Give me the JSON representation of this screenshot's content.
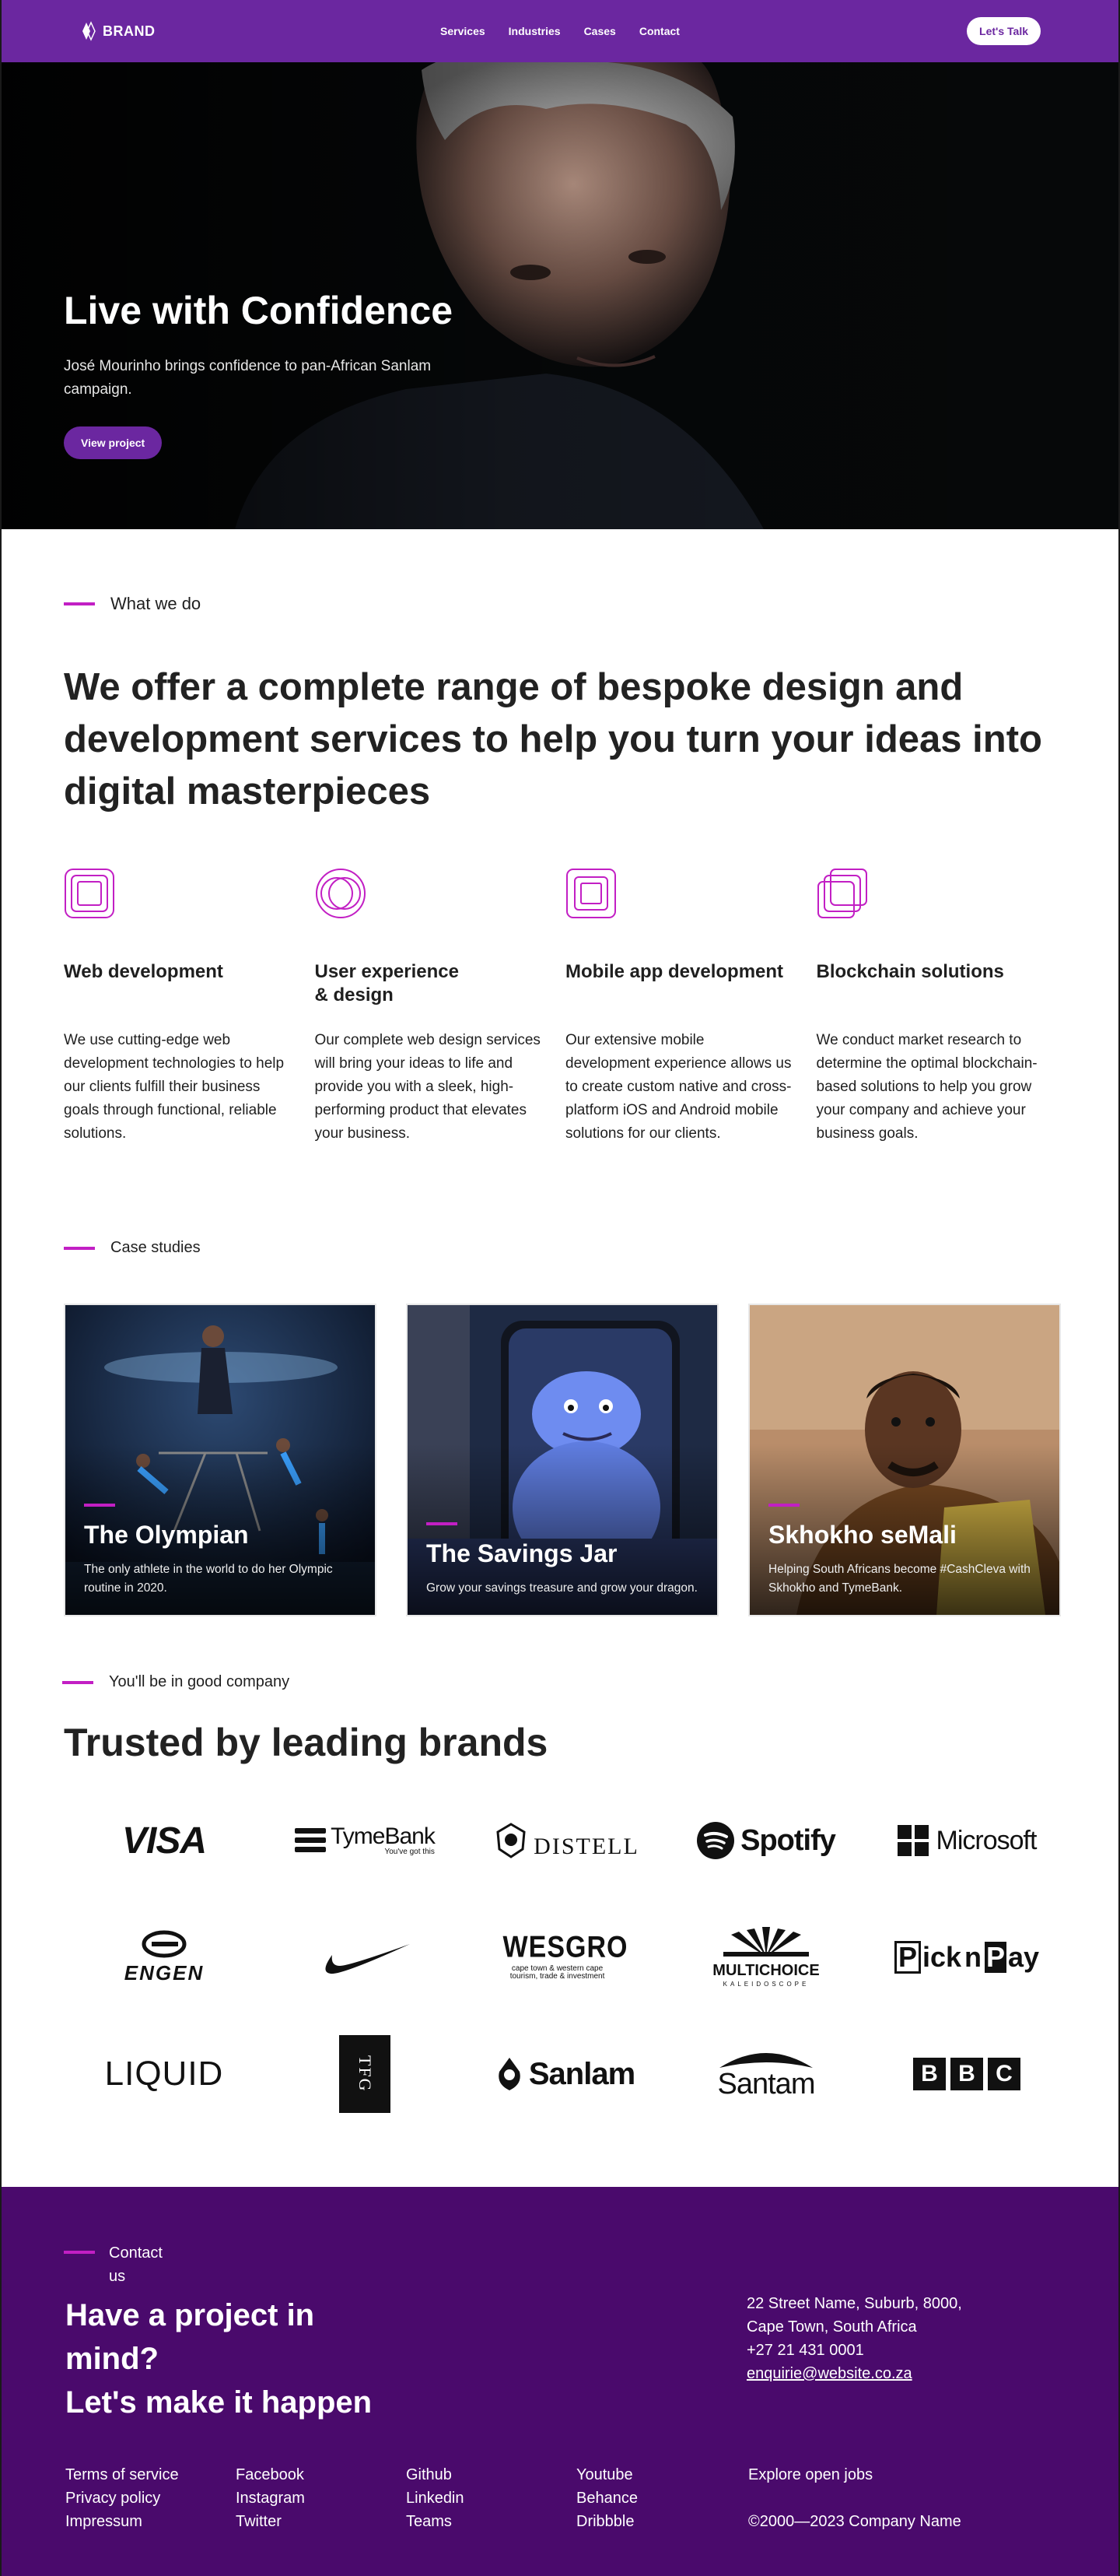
{
  "nav": {
    "logo_text": "BRAND",
    "links": [
      "Services",
      "Industries",
      "Cases",
      "Contact"
    ],
    "cta": "Let's Talk",
    "color": "#6b27a0"
  },
  "hero": {
    "title": "Live with Confidence",
    "subtitle": "José Mourinho brings confidence to pan-African Sanlam campaign.",
    "button": "View project"
  },
  "what_we_do": {
    "label": "What we do",
    "heading": "We offer a complete range of bespoke design and development services to help you turn your ideas into digital masterpieces",
    "services": [
      {
        "icon": "square-layers-icon",
        "title": "Web development",
        "desc": "We use cutting-edge web development technologies to help our clients fulfill their business goals through functional, reliable solutions."
      },
      {
        "icon": "circles-icon",
        "title": "User experience & design",
        "desc": "Our complete web design services will bring your ideas to life and provide you with a sleek, high-performing product that elevates your business."
      },
      {
        "icon": "nested-squares-icon",
        "title": "Mobile app development",
        "desc": "Our extensive mobile development experience allows us to create custom native and cross-platform iOS and Android mobile solutions for our clients."
      },
      {
        "icon": "stacked-squares-icon",
        "title": "Blockchain solutions",
        "desc": "We conduct market research to determine the optimal blockchain-based solutions to help you grow your company and achieve your business goals."
      }
    ]
  },
  "cases": {
    "label": "Case studies",
    "items": [
      {
        "title": "The Olympian",
        "desc": "The only athlete in the world to do her Olympic routine in 2020."
      },
      {
        "title": "The Savings Jar",
        "desc": "Grow your savings treasure and grow your dragon."
      },
      {
        "title": "Skhokho seMali",
        "desc": "Helping South Africans become #CashCleva with Skhokho and TymeBank."
      }
    ]
  },
  "brands": {
    "label": "You'll be in good company",
    "heading": "Trusted by leading brands",
    "logos": [
      {
        "name": "VISA"
      },
      {
        "name": "TymeBank",
        "tagline": "You've got this"
      },
      {
        "name": "DISTELL"
      },
      {
        "name": "Spotify"
      },
      {
        "name": "Microsoft"
      },
      {
        "name": "ENGEN"
      },
      {
        "name": "Nike"
      },
      {
        "name": "WESGRO",
        "tagline": "cape town & western cape tourism, trade & investment"
      },
      {
        "name": "MULTICHOICE",
        "tagline": "KALEIDOSCOPE"
      },
      {
        "name": "Pick n Pay"
      },
      {
        "name": "LIQUID"
      },
      {
        "name": "TFG"
      },
      {
        "name": "Sanlam"
      },
      {
        "name": "Santam"
      },
      {
        "name": "BBC"
      }
    ]
  },
  "footer": {
    "label": "Contact us",
    "heading_1": "Have a project in mind?",
    "heading_2": "Let's make it happen",
    "address_1": "22 Street Name, Suburb, 8000,",
    "address_2": "Cape Town, South Africa",
    "phone": "+27 21 431 0001",
    "email": "enquirie@website.co.za",
    "cols": [
      [
        "Terms of service",
        "Privacy policy",
        "Impressum"
      ],
      [
        "Facebook",
        "Instagram",
        "Twitter"
      ],
      [
        "Github",
        "Linkedin",
        "Teams"
      ],
      [
        "Youtube",
        "Behance",
        "Dribbble"
      ]
    ],
    "careers": "Explore open jobs",
    "copyright": "©2000—2023 Company Name",
    "bg": "#4a0a6c"
  }
}
